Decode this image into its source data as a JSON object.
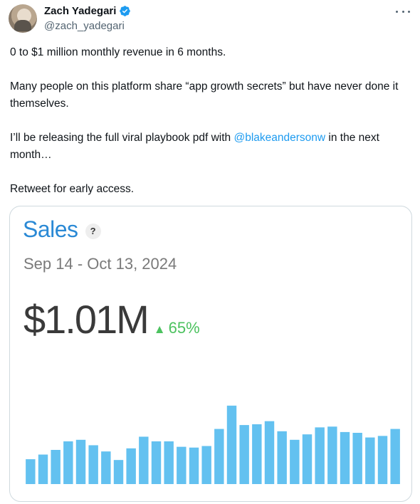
{
  "author": {
    "display_name": "Zach Yadegari",
    "handle": "@zach_yadegari",
    "verified": true,
    "verified_color": "#1d9bf0"
  },
  "tweet": {
    "line1": "0 to $1 million monthly revenue in 6 months.",
    "line2": "Many people on this platform share “app growth secrets” but have never done it themselves.",
    "line3_before": "I’ll be releasing the full viral playbook pdf with ",
    "line3_mention": "@blakeandersonw",
    "line3_after": " in the next month…",
    "line4": "Retweet for early access."
  },
  "card": {
    "title": "Sales",
    "help": "?",
    "date_range": "Sep 14 - Oct 13, 2024",
    "metric_value": "$1.01M",
    "change_arrow": "▲",
    "change_value": "65%",
    "title_color": "#2a89d5",
    "change_color": "#4cc25f"
  },
  "chart_data": {
    "type": "bar",
    "bar_color": "#63c1f0",
    "values": [
      32,
      38,
      44,
      55,
      57,
      50,
      42,
      31,
      46,
      61,
      55,
      55,
      48,
      47,
      49,
      71,
      101,
      76,
      77,
      81,
      68,
      57,
      64,
      73,
      74,
      67,
      66,
      60,
      62,
      71
    ],
    "ylim": [
      0,
      110
    ]
  }
}
